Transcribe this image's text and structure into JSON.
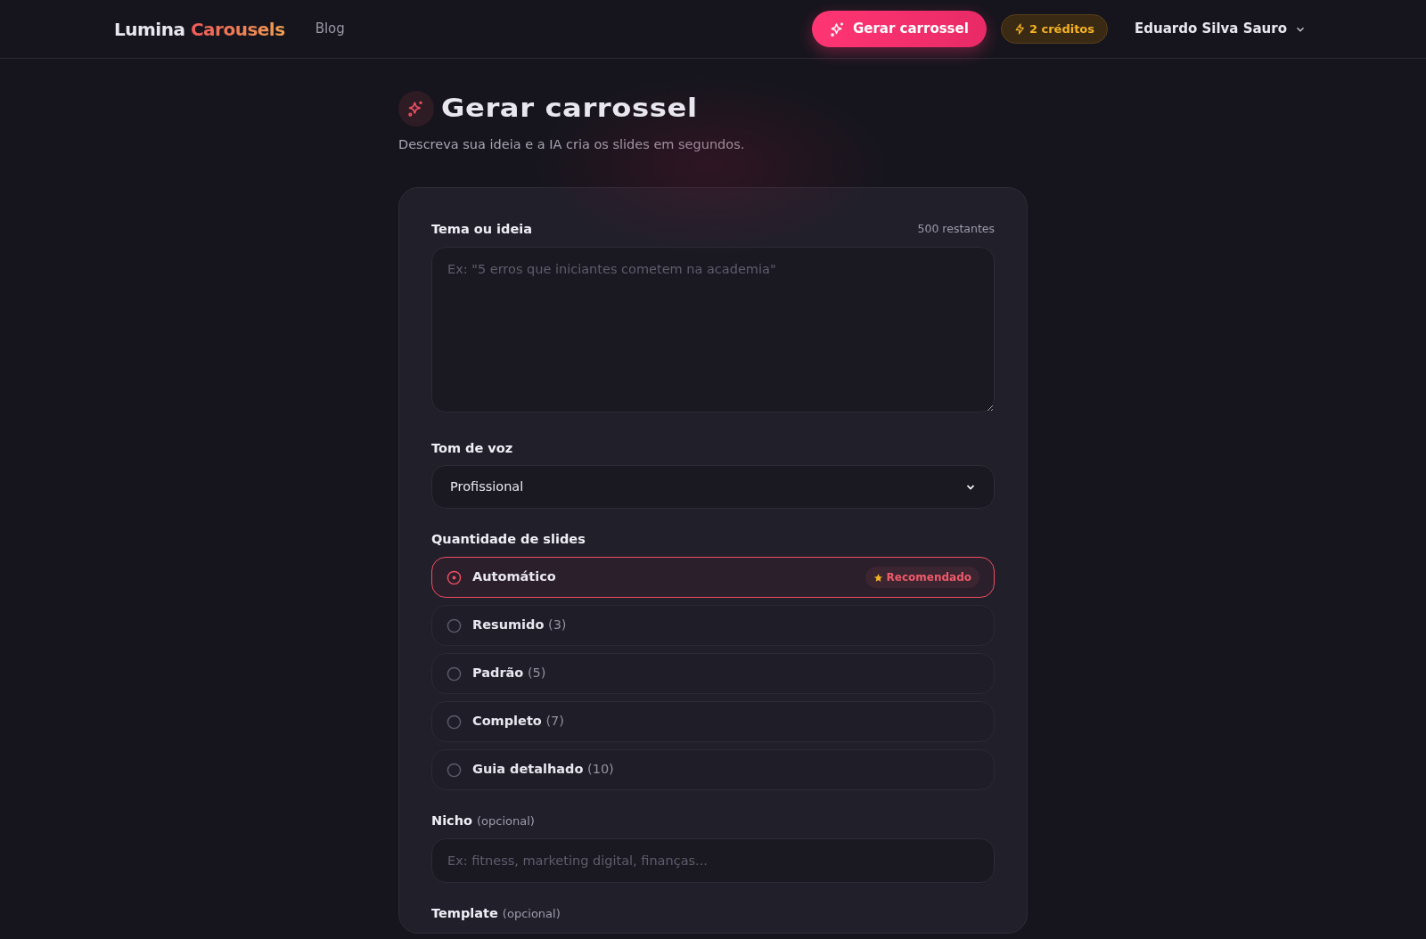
{
  "header": {
    "logo": {
      "first": "Lumina",
      "second": "Carousels"
    },
    "nav": [
      {
        "label": "Blog"
      }
    ],
    "cta": "Gerar carrossel",
    "credits": "2 créditos",
    "user": "Eduardo Silva Sauro"
  },
  "page": {
    "title": "Gerar carrossel",
    "subtitle": "Descreva sua ideia e a IA cria os slides em segundos."
  },
  "form": {
    "theme": {
      "label": "Tema ou ideia",
      "counter": "500 restantes",
      "placeholder": "Ex: \"5 erros que iniciantes cometem na academia\""
    },
    "tone": {
      "label": "Tom de voz",
      "value": "Profissional"
    },
    "slides": {
      "label": "Quantidade de slides",
      "options": [
        {
          "label": "Automático",
          "badge": "Recomendado",
          "selected": true
        },
        {
          "label": "Resumido",
          "count": "(3)",
          "selected": false
        },
        {
          "label": "Padrão",
          "count": "(5)",
          "selected": false
        },
        {
          "label": "Completo",
          "count": "(7)",
          "selected": false
        },
        {
          "label": "Guia detalhado",
          "count": "(10)",
          "selected": false
        }
      ]
    },
    "niche": {
      "label": "Nicho",
      "hint": "(opcional)",
      "placeholder": "Ex: fitness, marketing digital, finanças..."
    },
    "template": {
      "label": "Template",
      "hint": "(opcional)"
    }
  }
}
